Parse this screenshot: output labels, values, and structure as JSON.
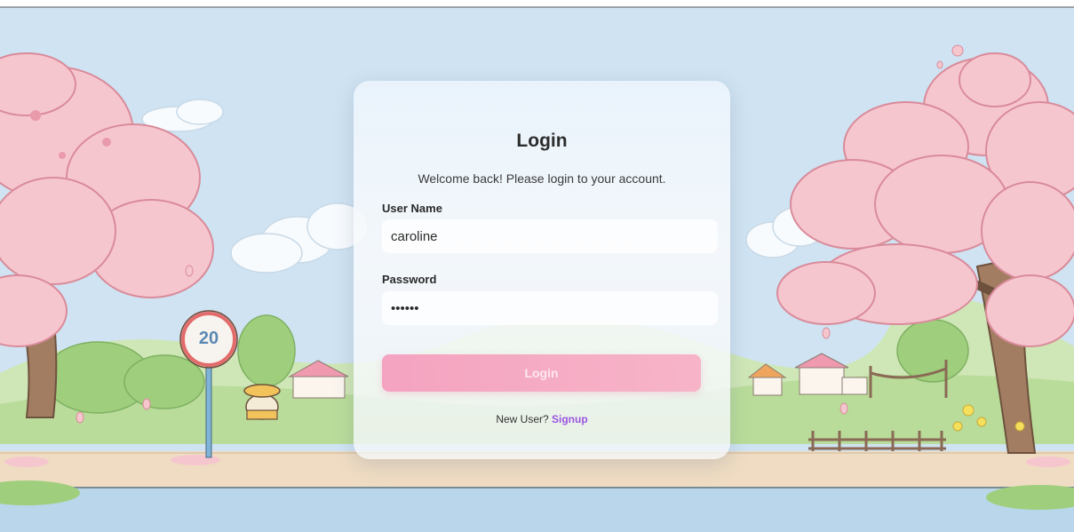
{
  "login": {
    "title": "Login",
    "subtitle": "Welcome back! Please login to your account.",
    "username_label": "User Name",
    "username_value": "caroline",
    "password_label": "Password",
    "password_value": "••••••",
    "submit_label": "Login",
    "new_user_text": "New User?",
    "signup_label": "Signup"
  },
  "background": {
    "speed_sign_text": "20",
    "colors": {
      "sky": "#cfe3f2",
      "blossom": "#f6c6cf",
      "grass": "#b9dc9a",
      "path": "#efdcc2",
      "water": "#b9d6ea",
      "signup_link": "#9b55e0",
      "button": "#f4a3c0"
    }
  }
}
